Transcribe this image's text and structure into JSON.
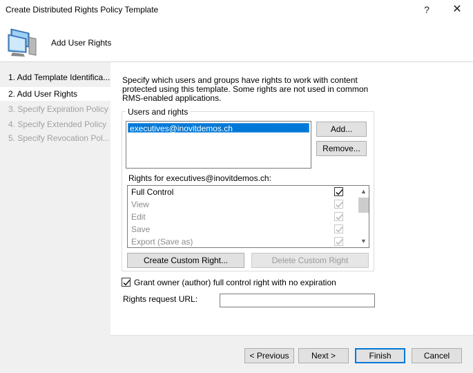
{
  "window": {
    "title": "Create Distributed Rights Policy Template",
    "help_glyph": "?",
    "close_glyph": "✕"
  },
  "header": {
    "title": "Add User Rights",
    "icon": "computer-monitor-icon"
  },
  "nav": {
    "items": [
      {
        "label": "1. Add Template Identifica...",
        "state": "normal"
      },
      {
        "label": "2. Add User Rights",
        "state": "active"
      },
      {
        "label": "3. Specify Expiration Policy",
        "state": "disabled"
      },
      {
        "label": "4. Specify Extended Policy",
        "state": "disabled"
      },
      {
        "label": "5. Specify Revocation Pol...",
        "state": "disabled"
      }
    ]
  },
  "main": {
    "description": "Specify which users and groups have rights to work with content protected using this template. Some rights are not used in common RMS-enabled applications.",
    "users_group_label": "Users and rights",
    "users": [
      "executives@inovitdemos.ch"
    ],
    "add_button": "Add...",
    "remove_button": "Remove...",
    "rights_label": "Rights for executives@inovitdemos.ch:",
    "rights": [
      {
        "name": "Full Control",
        "checked": true,
        "enabled": true
      },
      {
        "name": "View",
        "checked": true,
        "enabled": false
      },
      {
        "name": "Edit",
        "checked": true,
        "enabled": false
      },
      {
        "name": "Save",
        "checked": true,
        "enabled": false
      },
      {
        "name": "Export (Save as)",
        "checked": true,
        "enabled": false
      }
    ],
    "create_custom_right_button": "Create Custom Right...",
    "delete_custom_right_button": "Delete Custom Right",
    "grant_owner_label": "Grant owner (author) full control right with no expiration",
    "grant_owner_checked": true,
    "rights_request_url_label": "Rights request URL:",
    "rights_request_url_value": ""
  },
  "footer": {
    "previous_button": "< Previous",
    "next_button": "Next >",
    "finish_button": "Finish",
    "cancel_button": "Cancel"
  },
  "colors": {
    "selection": "#0078d7",
    "panel_bg": "#f0f0f0",
    "disabled_text": "#a0a0a0"
  }
}
